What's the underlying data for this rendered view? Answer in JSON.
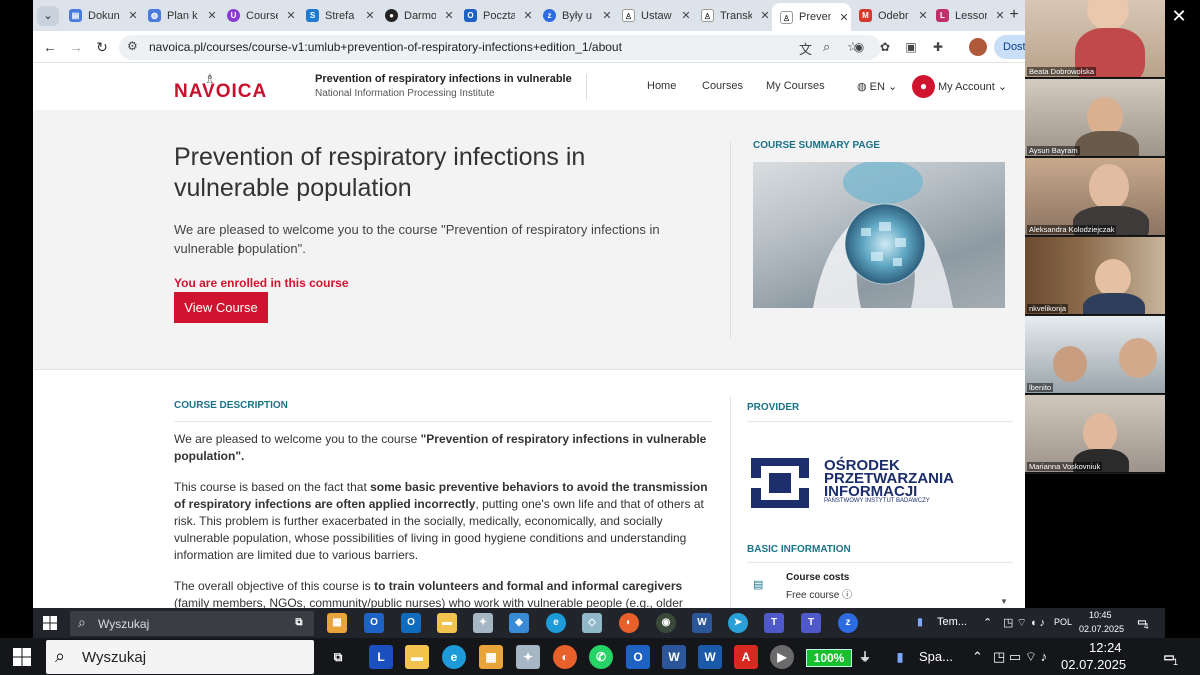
{
  "browser": {
    "tabs": [
      {
        "label": "Dokun",
        "icon": "docs-icon",
        "color": "#4a7be0"
      },
      {
        "label": "Plan k",
        "icon": "globe-icon",
        "color": "#4a7be0"
      },
      {
        "label": "Course",
        "icon": "course-icon",
        "color": "#8a3ad0"
      },
      {
        "label": "Strefa",
        "icon": "strefa-icon",
        "color": "#1e7bd0"
      },
      {
        "label": "Darmo",
        "icon": "github-icon",
        "color": "#222222"
      },
      {
        "label": "Poczta",
        "icon": "outlook-icon",
        "color": "#1f62c6"
      },
      {
        "label": "Były u",
        "icon": "zoom-icon",
        "color": "#2d6be0"
      },
      {
        "label": "Ustaw",
        "icon": "navoica-icon",
        "color": "#444444"
      },
      {
        "label": "Transk",
        "icon": "navoica-icon",
        "color": "#444444"
      },
      {
        "label": "Preven",
        "icon": "navoica-icon",
        "color": "#444444"
      },
      {
        "label": "Odebr",
        "icon": "gmail-icon",
        "color": "#d63a2f"
      },
      {
        "label": "Lessor",
        "icon": "lesson-icon",
        "color": "#c0306a"
      }
    ],
    "url": "navoica.pl/courses/course-v1:umlub+prevention-of-respiratory-infections+edition_1/about",
    "profile_button": "Dostę"
  },
  "site": {
    "logo_text": "NAVOICA",
    "header_course_title": "Prevention of respiratory infections in vulnerable pop...",
    "header_course_org": "National Information Processing Institute",
    "nav": {
      "home": "Home",
      "courses": "Courses",
      "my_courses": "My Courses",
      "lang": "EN",
      "account": "My Account"
    }
  },
  "hero": {
    "title": "Prevention of respiratory infections in vulnerable population",
    "welcome": "We are pleased to welcome you to the course \"Prevention of respiratory infections in vulnerable population\".",
    "enrolled": "You are enrolled in this course",
    "view_button": "View Course",
    "summary_label": "COURSE SUMMARY PAGE"
  },
  "description": {
    "label": "COURSE DESCRIPTION",
    "p1_a": "We are pleased to welcome you to the course ",
    "p1_b": "\"Prevention of respiratory infections in vulnerable population\".",
    "p2_a": "This course is based on the fact that ",
    "p2_b": "some basic preventive behaviors to avoid the transmission of respiratory infections are often applied incorrectly",
    "p2_c": ", putting one's own life and that of others at risk. This problem is further exacerbated in the socially, medically, economically, and socially vulnerable population, whose possibilities of living in good hygiene conditions and understanding information are limited due to various barriers.",
    "p3_a": "The overall objective of this course is ",
    "p3_b": "to train volunteers and formal and informal caregivers",
    "p3_c": " (family members, NGOs, community/public nurses) who work with vulnerable people (e.g., older adults, people with"
  },
  "sidebar": {
    "provider_label": "PROVIDER",
    "provider_lines": [
      "OŚRODEK",
      "PRZETWARZANIA",
      "INFORMACJI"
    ],
    "provider_sub": "PAŃSTWOWY INSTYTUT BADAWCZY",
    "basic_info_label": "BASIC INFORMATION",
    "cost_title": "Course costs",
    "cost_value": "Free course"
  },
  "participants": [
    "Beata Dobrowolska",
    "Aysun Bayram",
    "Aleksandra Kolodziejczak",
    "nkvelikonja",
    "lbenito",
    "Marianna Voskovniuk"
  ],
  "taskbar_top": {
    "search": "Wyszukaj",
    "weather": "Tem...",
    "lang": "POL",
    "time": "10:45",
    "date": "02.07.2025",
    "notif_count": "4"
  },
  "taskbar_bottom": {
    "search": "Wyszukaj",
    "battery": "100%",
    "spotify": "Spa...",
    "time": "12:24",
    "date": "02.07.2025",
    "notif_count": "1"
  }
}
